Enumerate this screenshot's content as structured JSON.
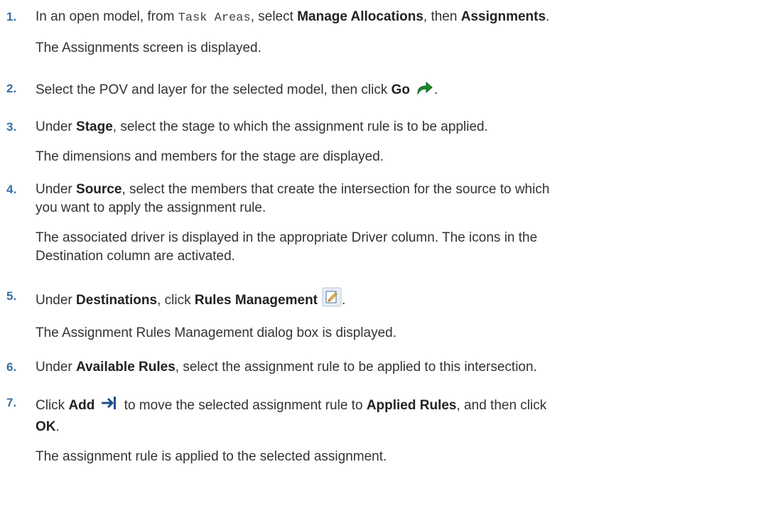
{
  "steps": [
    {
      "num": "1.",
      "parts": {
        "a": "In an open model, from ",
        "code": "Task Areas",
        "b": ", select ",
        "bold1": "Manage Allocations",
        "c": ", then ",
        "bold2": "Assignments",
        "d": "."
      },
      "result": "The Assignments screen is displayed."
    },
    {
      "num": "2.",
      "parts": {
        "a": "Select the POV and layer for the selected model, then click ",
        "bold1": "Go",
        "d": "."
      },
      "icon": "go-arrow-icon"
    },
    {
      "num": "3.",
      "parts": {
        "a": "Under ",
        "bold1": "Stage",
        "b": ", select the stage to which the assignment rule is to be applied."
      },
      "result": "The dimensions and members for the stage are displayed."
    },
    {
      "num": "4.",
      "parts": {
        "a": "Under ",
        "bold1": "Source",
        "b": ", select the members that create the intersection for the source to which",
        "c": "you want to apply the assignment rule."
      },
      "result_line1": "The associated driver is displayed in the appropriate Driver column. The icons in the",
      "result_line2": "Destination column are activated."
    },
    {
      "num": "5.",
      "parts": {
        "a": "Under ",
        "bold1": "Destinations",
        "b": ", click ",
        "bold2": "Rules Management",
        "d": "."
      },
      "icon": "rules-management-icon",
      "result": "The Assignment Rules Management dialog box is displayed."
    },
    {
      "num": "6.",
      "parts": {
        "a": "Under ",
        "bold1": "Available Rules",
        "b": ", select the assignment rule to be applied to this intersection."
      }
    },
    {
      "num": "7.",
      "parts": {
        "a": "Click ",
        "bold1": "Add",
        "b": " to move the selected assignment rule to ",
        "bold2": "Applied Rules",
        "c": ", and then click",
        "bold3": "OK",
        "d": "."
      },
      "icon": "add-move-icon",
      "result": "The assignment rule is applied to the selected assignment."
    }
  ],
  "colors": {
    "number": "#3a6ea5",
    "text": "#333333",
    "go_icon": "#1a8a2a",
    "add_icon": "#1f4e8c"
  }
}
